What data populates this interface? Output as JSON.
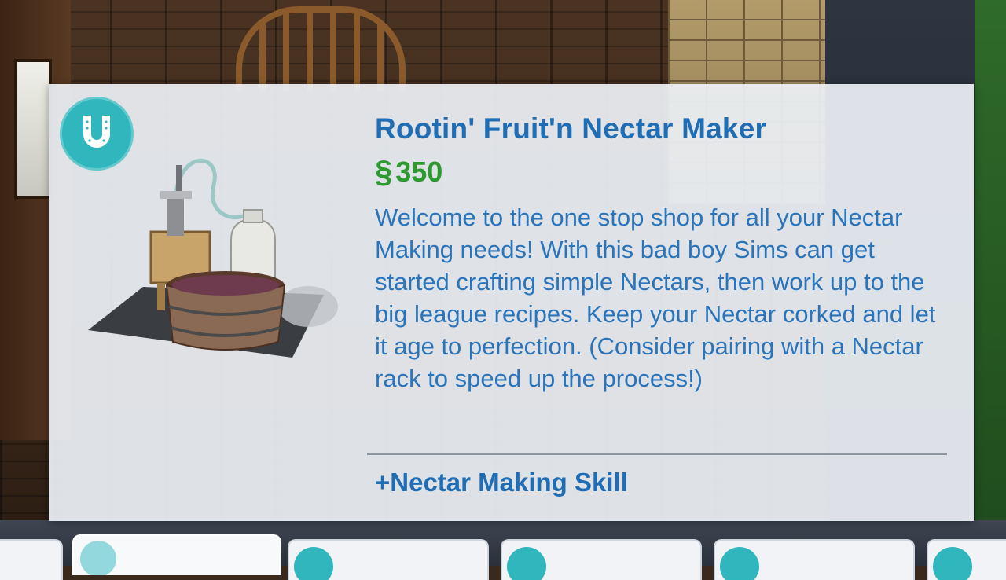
{
  "item": {
    "title": "Rootin' Fruit'n Nectar Maker",
    "price_symbol": "§",
    "price": "350",
    "description": "Welcome to the one stop shop for all your Nectar Making needs! With this bad boy Sims can get started crafting simple Nectars, then work up to the big league recipes. Keep your Nectar corked and let it age to perfection. (Consider pairing with a Nectar rack to speed up the process!)",
    "skill": "+Nectar Making Skill",
    "badge_icon": "horseshoe-icon"
  },
  "colors": {
    "title": "#1f6db4",
    "price": "#2c9a2e",
    "badge": "#2fb7bd"
  },
  "catalog_tiles": [
    {
      "selected": false
    },
    {
      "selected": true
    },
    {
      "selected": false
    },
    {
      "selected": false
    },
    {
      "selected": false
    },
    {
      "selected": false
    }
  ]
}
